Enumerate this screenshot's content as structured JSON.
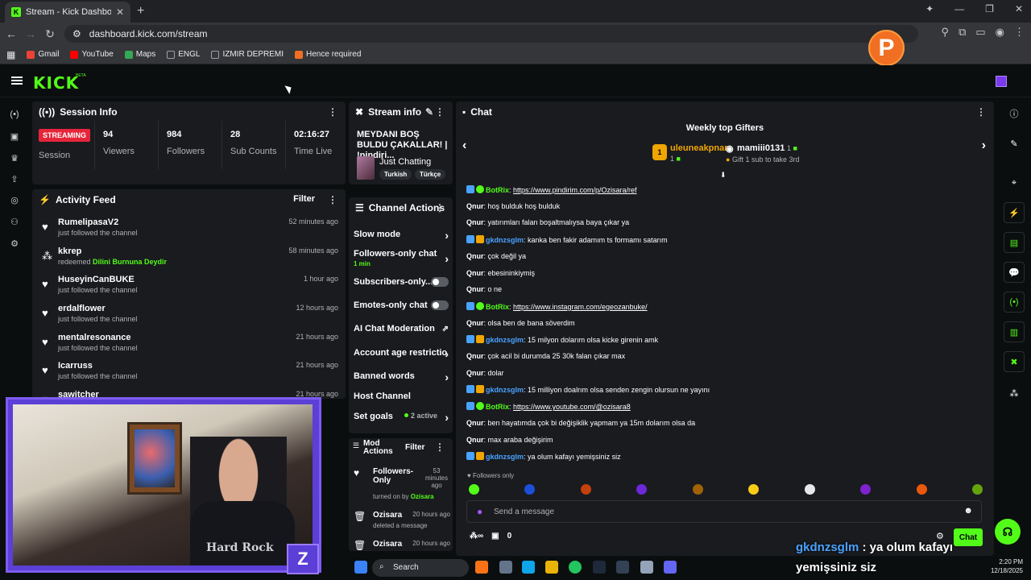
{
  "browser": {
    "tab_title": "Stream - Kick Dashboard",
    "tab_close": "✕",
    "new_tab": "+",
    "url": "dashboard.kick.com/stream",
    "bookmarks": [
      {
        "label": "Gmail",
        "color": "#ea4335"
      },
      {
        "label": "YouTube",
        "color": "#ff0000"
      },
      {
        "label": "Maps",
        "color": "#34a853"
      },
      {
        "label": "ENGL",
        "color": "#9aa0a6"
      },
      {
        "label": "IZMIR DEPREMI",
        "color": "#9aa0a6"
      },
      {
        "label": "Hence required",
        "color": "#f16f22"
      }
    ]
  },
  "profile_badge": "P",
  "nav": {
    "logo": "KICK",
    "beta": "BETA"
  },
  "session": {
    "title": "Session Info",
    "status": "STREAMING",
    "session_label": "Session",
    "stats": [
      {
        "value": "94",
        "label": "Viewers"
      },
      {
        "value": "984",
        "label": "Followers"
      },
      {
        "value": "28",
        "label": "Sub Counts"
      },
      {
        "value": "02:16:27",
        "label": "Time Live"
      }
    ]
  },
  "activity": {
    "title": "Activity Feed",
    "filter": "Filter",
    "items": [
      {
        "name": "RumelipasaV2",
        "sub": "just followed the channel",
        "time": "52 minutes ago",
        "highlight": ""
      },
      {
        "name": "kkrep",
        "sub": "redeemed ",
        "time": "58 minutes ago",
        "highlight": "Dilini Burnuna Deydir"
      },
      {
        "name": "HuseyinCanBUKE",
        "sub": "just followed the channel",
        "time": "1 hour ago",
        "highlight": ""
      },
      {
        "name": "erdalflower",
        "sub": "just followed the channel",
        "time": "12 hours ago",
        "highlight": ""
      },
      {
        "name": "mentalresonance",
        "sub": "just followed the channel",
        "time": "21 hours ago",
        "highlight": ""
      },
      {
        "name": "Icarruss",
        "sub": "just followed the channel",
        "time": "21 hours ago",
        "highlight": ""
      },
      {
        "name": "sawitcher",
        "sub": "",
        "time": "21 hours ago",
        "highlight": ""
      }
    ]
  },
  "stream_info": {
    "title": "Stream info",
    "stream_title": "MEYDANI BOŞ BULDU ÇAKALLAR! | !pindiri...",
    "category": "Just Chatting",
    "tags": [
      "Turkish",
      "Türkçe"
    ]
  },
  "channel_actions": {
    "title": "Channel Actions",
    "items": [
      {
        "label": "Slow mode",
        "sub": "",
        "kind": "arrow"
      },
      {
        "label": "Followers-only chat",
        "sub": "1 min",
        "kind": "arrow"
      },
      {
        "label": "Subscribers-only...",
        "sub": "",
        "kind": "toggle"
      },
      {
        "label": "Emotes-only chat",
        "sub": "",
        "kind": "toggle"
      },
      {
        "label": "AI Chat Moderation",
        "sub": "",
        "kind": "external"
      },
      {
        "label": "Account age restrictio",
        "sub": "",
        "kind": "arrow"
      },
      {
        "label": "Banned words",
        "sub": "",
        "kind": "arrow"
      },
      {
        "label": "Host Channel",
        "sub": "",
        "kind": "none"
      },
      {
        "label": "Set goals",
        "sub": "",
        "kind": "goals",
        "extra": "2 active"
      }
    ]
  },
  "mod_actions": {
    "title_line1": "Mod",
    "title_line2": "Actions",
    "filter": "Filter",
    "items": [
      {
        "name": "Followers-Only",
        "time": "53 minutes ago",
        "desc": "turned on by ",
        "by": "Ozisara"
      },
      {
        "name": "Ozisara",
        "time": "20 hours ago",
        "desc": "deleted a message",
        "by": ""
      },
      {
        "name": "Ozisara",
        "time": "20 hours ago",
        "desc": "",
        "by": ""
      }
    ]
  },
  "chat": {
    "title": "Chat",
    "gifters_title": "Weekly top Gifters",
    "gifters": [
      {
        "rank": "1",
        "name": "uleuneakpnar",
        "count": "1"
      },
      {
        "rank": "2",
        "name": "mamiii0131",
        "count": "1"
      }
    ],
    "gift_hint": "Gift 1 sub to take 3rd",
    "messages": [
      {
        "user": "BotRix",
        "type": "bot",
        "text": "https://www.pindirim.com/p/Ozisara/ref",
        "link": true
      },
      {
        "user": "Qnur",
        "type": "plain",
        "text": "hoş bulduk hoş bulduk",
        "link": false
      },
      {
        "user": "Qnur",
        "type": "plain",
        "text": "yatırımları falan boşaltmalıysa baya çıkar ya",
        "link": false
      },
      {
        "user": "gkdnzsglm",
        "type": "sub",
        "text": "kanka ben fakir adamım ts formamı satarım",
        "link": false
      },
      {
        "user": "Qnur",
        "type": "plain",
        "text": "çok değil ya",
        "link": false
      },
      {
        "user": "Qnur",
        "type": "plain",
        "text": "ebesininkiymiş",
        "link": false
      },
      {
        "user": "Qnur",
        "type": "plain",
        "text": "o ne",
        "link": false
      },
      {
        "user": "BotRix",
        "type": "bot",
        "text": "https://www.instagram.com/egeozanbuke/",
        "link": true
      },
      {
        "user": "Qnur",
        "type": "plain",
        "text": "olsa ben de bana söverdim",
        "link": false
      },
      {
        "user": "gkdnzsglm",
        "type": "sub",
        "text": "15 milyon dolarım olsa kicke girenin amk",
        "link": false
      },
      {
        "user": "Qnur",
        "type": "plain",
        "text": "çok acil bi durumda 25 30k falan çıkar max",
        "link": false
      },
      {
        "user": "Qnur",
        "type": "plain",
        "text": "dolar",
        "link": false
      },
      {
        "user": "gkdnzsglm",
        "type": "sub",
        "text": "15 milliyon doalrım olsa senden zengin olursun ne yayını",
        "link": false
      },
      {
        "user": "BotRix",
        "type": "bot",
        "text": "https://www.youtube.com/@ozisara8",
        "link": true
      },
      {
        "user": "Qnur",
        "type": "plain",
        "text": "ben hayatımda çok bi değişiklik yapmam ya 15m dolarım olsa da",
        "link": false
      },
      {
        "user": "Qnur",
        "type": "plain",
        "text": "max araba değişirim",
        "link": false
      },
      {
        "user": "gkdnzsglm",
        "type": "sub",
        "text": "ya olum kafayı yemişsiniz siz",
        "link": false
      }
    ],
    "followers_only": "Followers only",
    "placeholder": "Send a message",
    "points": "0",
    "chat_button": "Chat"
  },
  "overlay": {
    "user": "gkdnzsglm",
    "line1": " : ya olum kafayı",
    "line2": "yemişsiniz siz"
  },
  "taskbar": {
    "search": "Search",
    "time": "2:20 PM",
    "date": "12/18/2025"
  },
  "camera_shirt_text": "Hard Rock"
}
